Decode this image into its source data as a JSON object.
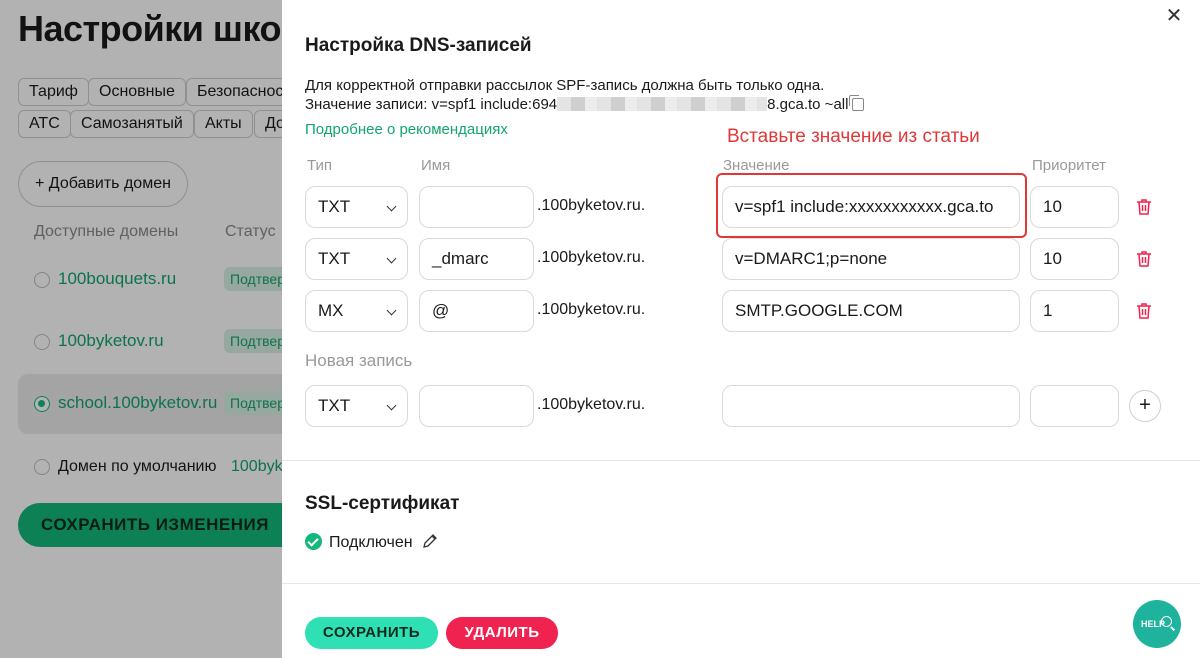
{
  "background": {
    "page_title": "Настройки шко",
    "tabs_row1": [
      "Тариф",
      "Основные",
      "Безопаснос"
    ],
    "tabs_row2": [
      "АТС",
      "Самозанятый",
      "Акты",
      "До"
    ],
    "add_domain_label": "Добавить домен",
    "column_domains": "Доступные домены",
    "column_status": "Статус",
    "domains": [
      {
        "name": "100bouquets.ru",
        "status": "Подтвер"
      },
      {
        "name": "100byketov.ru",
        "status": "Подтвер"
      },
      {
        "name": "school.100byketov.ru",
        "status": "Подтвер"
      }
    ],
    "default_domain_label": "Домен по умолчанию",
    "default_domain_value": "100byk",
    "save_changes_label": "СОХРАНИТЬ ИЗМЕНЕНИЯ"
  },
  "modal": {
    "title": "Настройка DNS-записей",
    "description": "Для корректной отправки рассылок SPF-запись должна быть только одна.",
    "record_value_prefix": "Значение записи: v=spf1 include:694",
    "record_value_suffix": "8.gca.to ~all",
    "recommendations_link": "Подробнее о рекомендациях",
    "annotation": "Вставьте значение из статьи",
    "columns": {
      "type": "Тип",
      "name": "Имя",
      "value": "Значение",
      "priority": "Приоритет"
    },
    "domain_suffix": ".100byketov.ru.",
    "records": [
      {
        "type": "TXT",
        "name": "",
        "value": "v=spf1 include:xxxxxxxxxxx.gca.to",
        "priority": "10"
      },
      {
        "type": "TXT",
        "name": "_dmarc",
        "value": "v=DMARC1;p=none",
        "priority": "10"
      },
      {
        "type": "MX",
        "name": "@",
        "value": "SMTP.GOOGLE.COM",
        "priority": "1"
      }
    ],
    "new_record_label": "Новая запись",
    "new_record": {
      "type": "TXT",
      "name": "",
      "value": "",
      "priority": ""
    },
    "add_icon": "+",
    "ssl_title": "SSL-сертификат",
    "ssl_status": "Подключен",
    "save_label": "СОХРАНИТЬ",
    "delete_label": "УДАЛИТЬ",
    "help_label": "HELP",
    "close_icon": "✕"
  },
  "colors": {
    "accent": "#13b87a",
    "danger": "#f0224f",
    "annotation": "#e03838"
  }
}
